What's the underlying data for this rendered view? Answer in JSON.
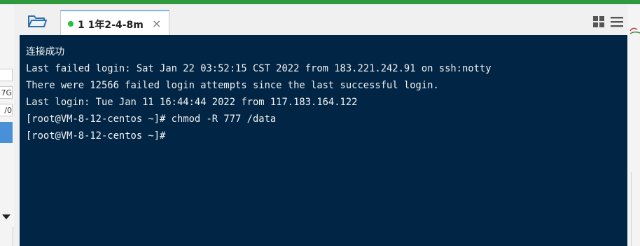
{
  "window": {
    "accent_color": "#2e9a3d",
    "terminal_bg": "#012545",
    "terminal_fg": "#f2f2f2"
  },
  "left_panel": {
    "fields": [
      "",
      "7G",
      "/0"
    ]
  },
  "toolbar": {
    "open_folder_icon": "folder-icon",
    "layout_icon": "grid-icon",
    "menu_icon": "menu-icon"
  },
  "tabs": [
    {
      "label": "1 1年2-4-8m",
      "close_glyph": "×",
      "status": "connected",
      "status_color": "#22c33a"
    }
  ],
  "terminal": {
    "lines": [
      "连接成功",
      "Last failed login: Sat Jan 22 03:52:15 CST 2022 from 183.221.242.91 on ssh:notty",
      "There were 12566 failed login attempts since the last successful login.",
      "Last login: Tue Jan 11 16:44:44 2022 from 117.183.164.122",
      "[root@VM-8-12-centos ~]# chmod -R 777 /data",
      "[root@VM-8-12-centos ~]#"
    ]
  }
}
